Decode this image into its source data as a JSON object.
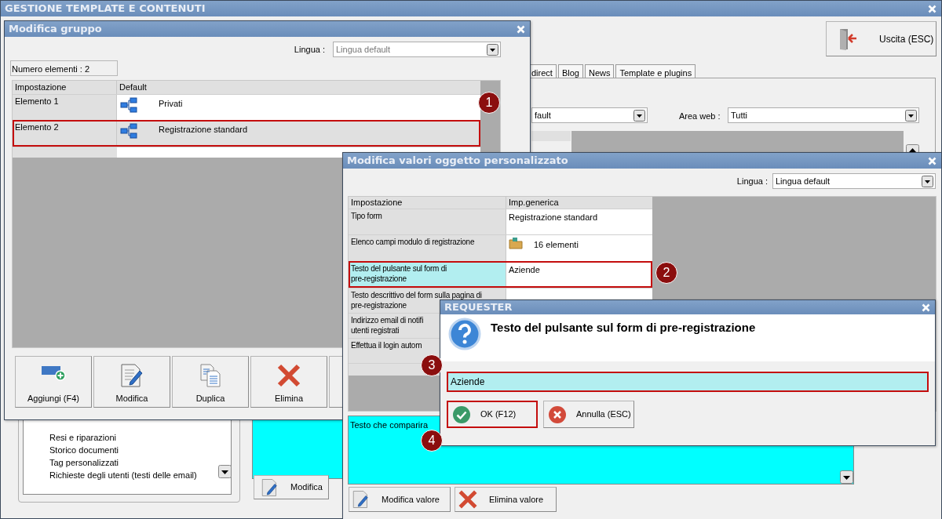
{
  "main_window": {
    "title": "GESTIONE TEMPLATE E CONTENUTI",
    "exit_button": "Uscita (ESC)",
    "tabs": [
      {
        "label": "direct"
      },
      {
        "label": "Blog"
      },
      {
        "label": "News"
      },
      {
        "label": "Template e plugins"
      }
    ],
    "language_select": {
      "value": "fault"
    },
    "area_web": {
      "label": "Area web :",
      "value": "Tutti"
    },
    "tree_items": [
      "Resi e riparazioni",
      "Storico documenti",
      "Tag personalizzati",
      "Richieste degli utenti (testi delle email)"
    ],
    "edit_button": "Modifica"
  },
  "group_dialog": {
    "title": "Modifica gruppo",
    "language": {
      "label": "Lingua :",
      "value": "Lingua default"
    },
    "count": "Numero elementi : 2",
    "columns": [
      "Impostazione",
      "Default"
    ],
    "rows": [
      {
        "setting": "Elemento 1",
        "value": "Privati",
        "selected": false,
        "highlighted": false
      },
      {
        "setting": "Elemento 2",
        "value": "Registrazione standard",
        "selected": true,
        "highlighted": true
      }
    ],
    "buttons": [
      {
        "label": "Aggiungi (F4)",
        "kind": "add"
      },
      {
        "label": "Modifica",
        "kind": "edit"
      },
      {
        "label": "Duplica",
        "kind": "duplicate"
      },
      {
        "label": "Elimina",
        "kind": "delete"
      }
    ]
  },
  "values_dialog": {
    "title": "Modifica valori oggetto personalizzato",
    "language": {
      "label": "Lingua :",
      "value": "Lingua default"
    },
    "columns": [
      "Impostazione",
      "Imp.generica"
    ],
    "rows": [
      {
        "setting": "Tipo form",
        "value": "Registrazione standard",
        "kind": "text",
        "selected": false,
        "highlighted": false
      },
      {
        "setting": "Elenco campi modulo di registrazione",
        "value": "16 elementi",
        "kind": "folder",
        "selected": false,
        "highlighted": false
      },
      {
        "setting": "Testo del pulsante sul form di\npre-registrazione",
        "value": "Aziende",
        "kind": "text",
        "selected": true,
        "highlighted": true
      },
      {
        "setting": "Testo descrittivo del form sulla pagina di\npre-registrazione",
        "kind": "text",
        "selected": false,
        "highlighted": false
      },
      {
        "setting": "Indirizzo email di notifi\nutenti registrati",
        "kind": "text",
        "selected": false,
        "highlighted": false
      },
      {
        "setting": "Effettua il login autom",
        "kind": "text",
        "selected": false,
        "highlighted": false
      }
    ],
    "description": "Testo che comparira",
    "buttons": [
      {
        "label": "Modifica valore",
        "kind": "edit"
      },
      {
        "label": "Elimina valore",
        "kind": "delete"
      }
    ]
  },
  "requester": {
    "title": "REQUESTER",
    "question": "Testo del pulsante sul form di pre-registrazione",
    "input": {
      "value": "Aziende",
      "highlighted": true
    },
    "buttons": [
      {
        "label": "OK (F12)",
        "kind": "ok",
        "highlighted": true
      },
      {
        "label": "Annulla (ESC)",
        "kind": "cancel",
        "highlighted": false
      }
    ]
  },
  "callouts": [
    "1",
    "2",
    "3",
    "4"
  ]
}
